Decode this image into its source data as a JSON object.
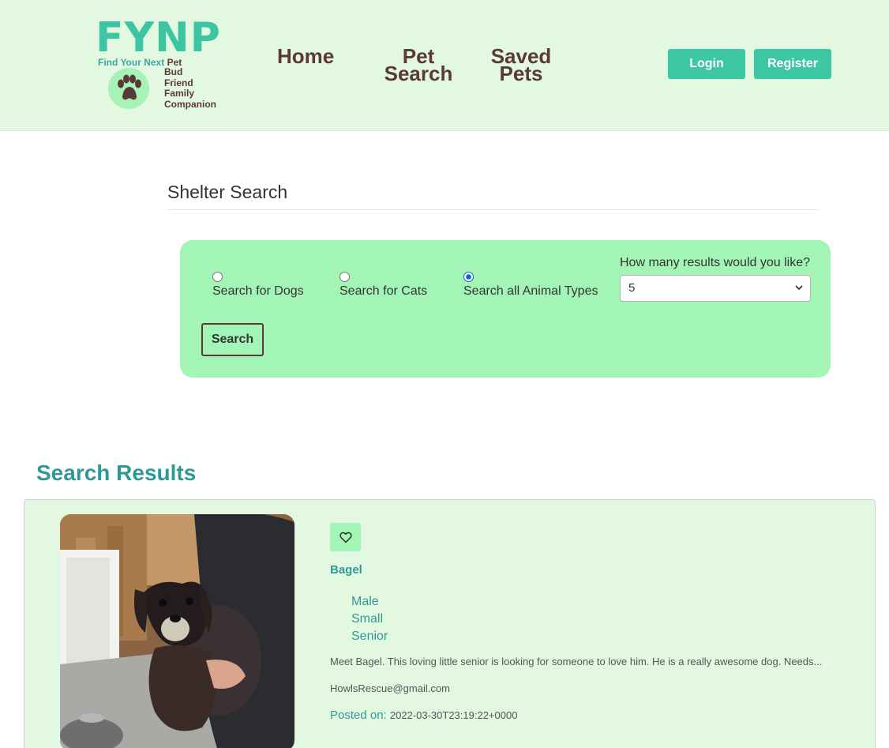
{
  "brand": {
    "logo_text": "FYNP",
    "tagline_prefix": "Find Your Next",
    "tagline_words": [
      "Pet",
      "Bud",
      "Friend",
      "Family",
      "Companion"
    ]
  },
  "nav": {
    "home": "Home",
    "pet_search_line1": "Pet",
    "pet_search_line2": "Search",
    "saved_line1": "Saved",
    "saved_line2": "Pets"
  },
  "auth": {
    "login": "Login",
    "register": "Register"
  },
  "shelter_search": {
    "title": "Shelter Search",
    "options": [
      {
        "label": "Search for Dogs",
        "checked": false
      },
      {
        "label": "Search for Cats",
        "checked": false
      },
      {
        "label": "Search all Animal Types",
        "checked": true
      }
    ],
    "count_label": "How many results would you like?",
    "count_value": "5",
    "search_button": "Search"
  },
  "results": {
    "title": "Search Results",
    "items": [
      {
        "name": "Bagel",
        "attributes": [
          "Male",
          "Small",
          "Senior"
        ],
        "description": "Meet Bagel. This loving little senior is looking for someone to love him. He is a really awesome dog. Needs...",
        "email": "HowlsRescue@gmail.com",
        "posted_label": "Posted on:",
        "posted_date": "2022-03-30T23:19:22+0000"
      }
    ]
  },
  "colors": {
    "header_bg": "#e3f8e0",
    "accent": "#3dc7a3",
    "panel_bg": "#a3f5b5",
    "brown": "#5a3a38",
    "teal_text": "#2f9a95"
  }
}
